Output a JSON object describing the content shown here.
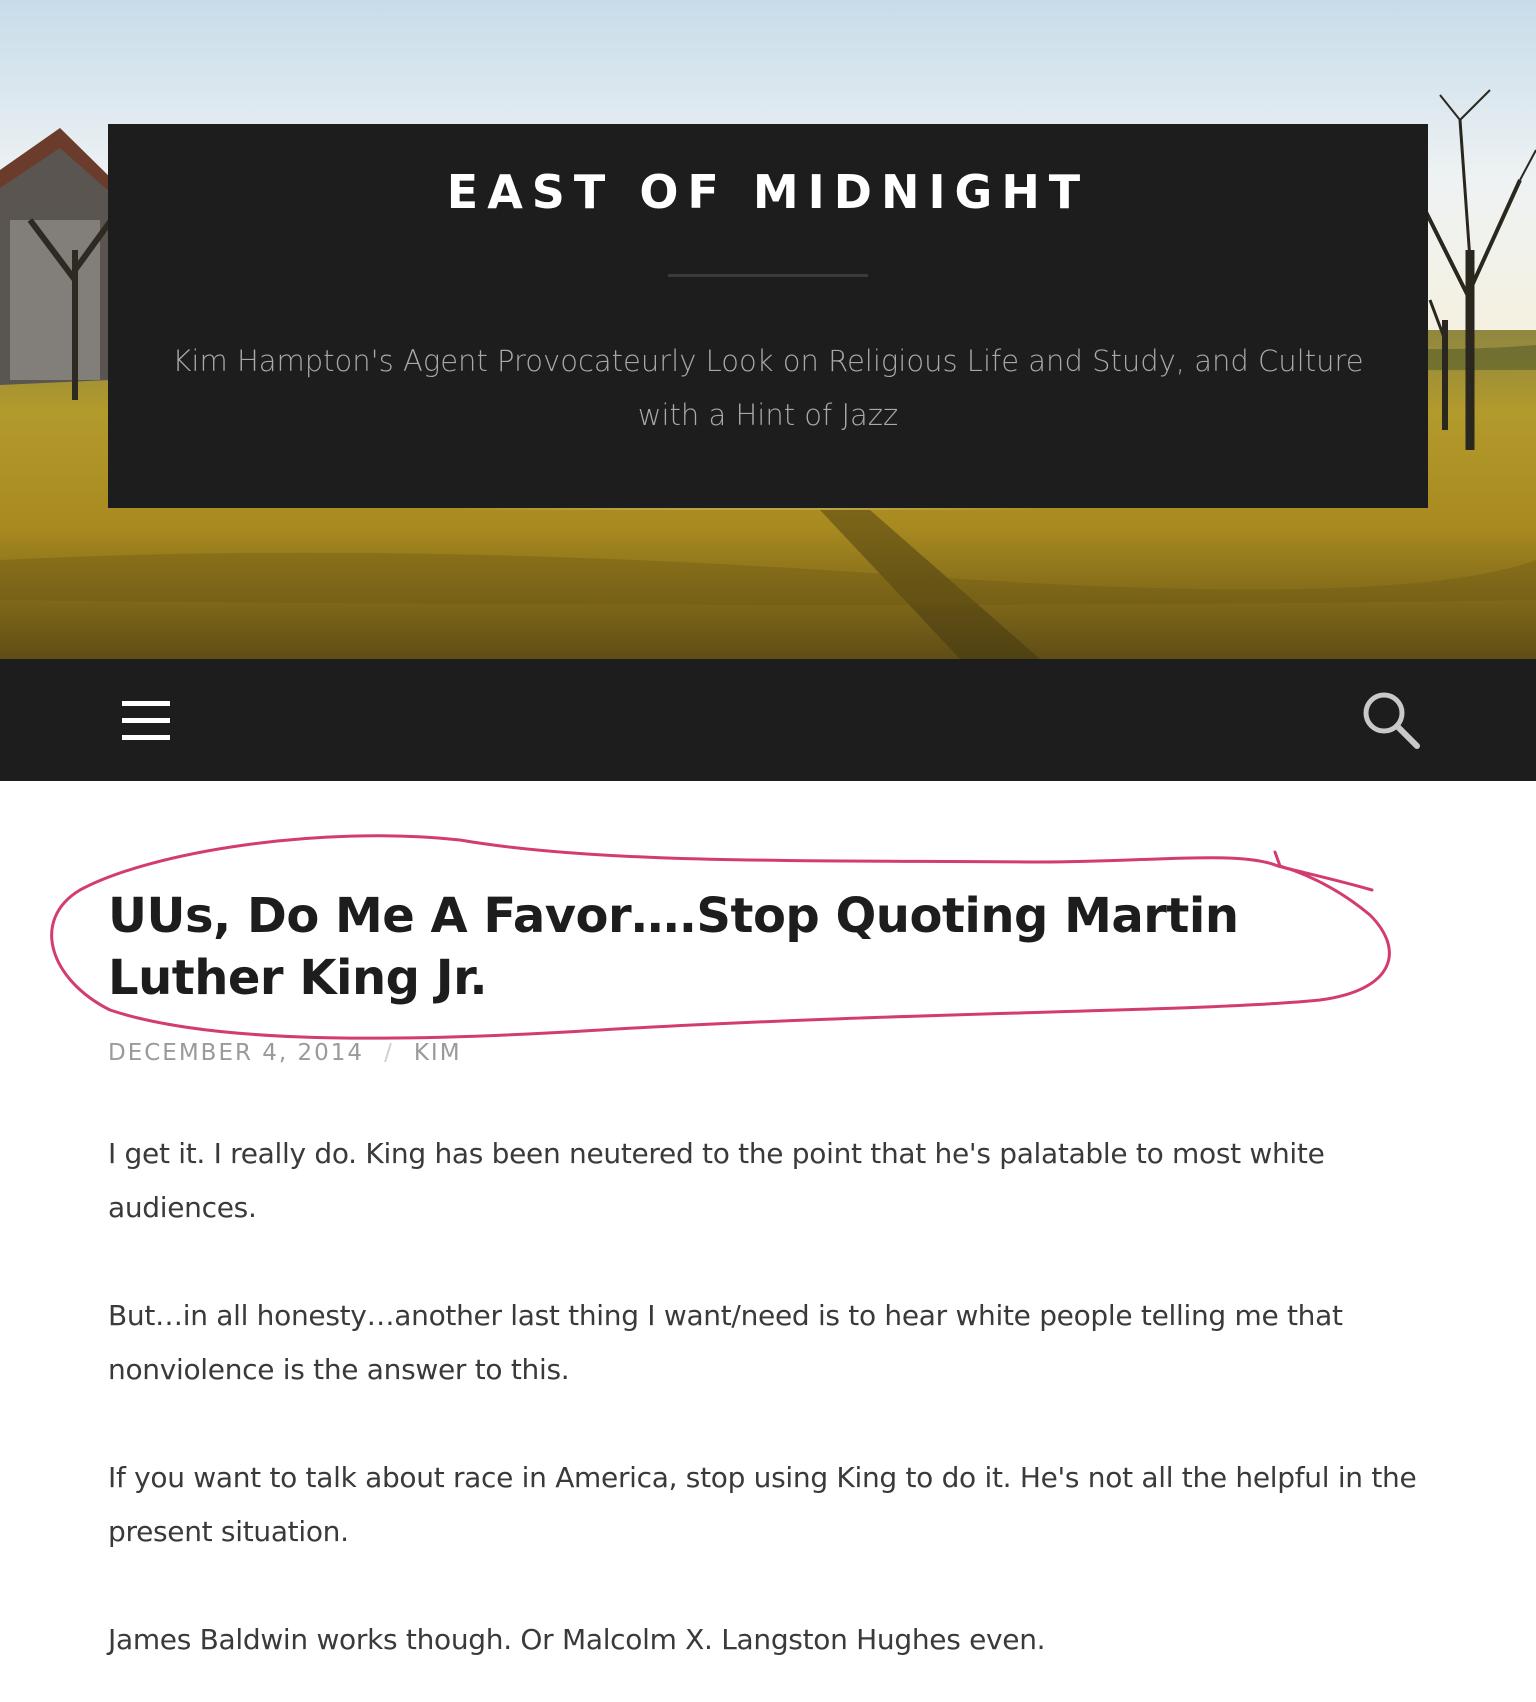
{
  "header": {
    "site_title": "EAST OF MIDNIGHT",
    "tagline": "Kim Hampton's Agent Provocateurly Look on Religious Life and Study, and Culture with a Hint of Jazz"
  },
  "nav": {
    "menu_icon": "hamburger-menu-icon",
    "search_icon": "search-icon"
  },
  "post": {
    "title": "UUs, Do Me A Favor….Stop Quoting Martin Luther King Jr.",
    "date": "DECEMBER 4, 2014",
    "separator": "/",
    "author": "KIM",
    "paragraphs": [
      "I get it. I really do. King has been neutered to the point that he's palatable to most white audiences.",
      "But…in all honesty…another last thing I want/need is to hear white people telling me that nonviolence is the answer to this.",
      "If you want to talk about race in America, stop using King to do it. He's not all the helpful in the present situation.",
      "James Baldwin works though. Or Malcolm X. Langston Hughes even."
    ]
  },
  "colors": {
    "header_box": "#1d1d1d",
    "annotation_circle": "#d23c6e",
    "meta_text": "#9a9a9a",
    "body_text": "#3a3a3a"
  }
}
